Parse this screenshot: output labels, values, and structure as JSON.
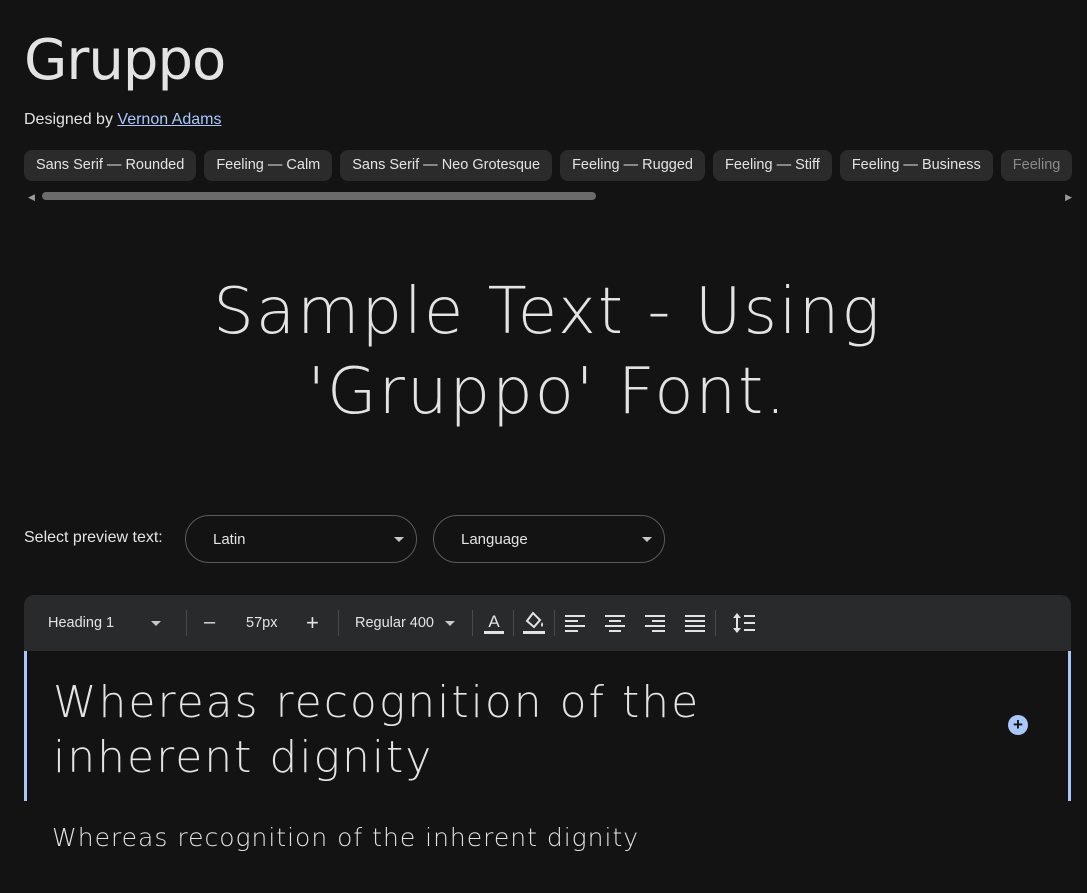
{
  "font": {
    "name": "Gruppo",
    "designed_by": "Designed by",
    "designer": "Vernon Adams"
  },
  "tags": [
    "Sans Serif — Rounded",
    "Feeling — Calm",
    "Sans Serif — Neo Grotesque",
    "Feeling — Rugged",
    "Feeling — Stiff",
    "Feeling — Business",
    "Feeling"
  ],
  "sample": {
    "line1": "Sample Text - Using",
    "line2": "'Gruppo' Font."
  },
  "preview": {
    "label": "Select preview text:",
    "script": "Latin",
    "language": "Language"
  },
  "toolbar": {
    "style": "Heading 1",
    "minus": "–",
    "size": "57px",
    "plus": "+",
    "weight": "Regular 400"
  },
  "editor": {
    "line1": "Whereas recognition of the",
    "line2": "inherent dignity",
    "add": "+"
  },
  "paragraph": "Whereas recognition of the inherent dignity",
  "colors": {
    "background": "#131313",
    "accent": "#a8c7fa",
    "toolbar": "#282a2c"
  }
}
